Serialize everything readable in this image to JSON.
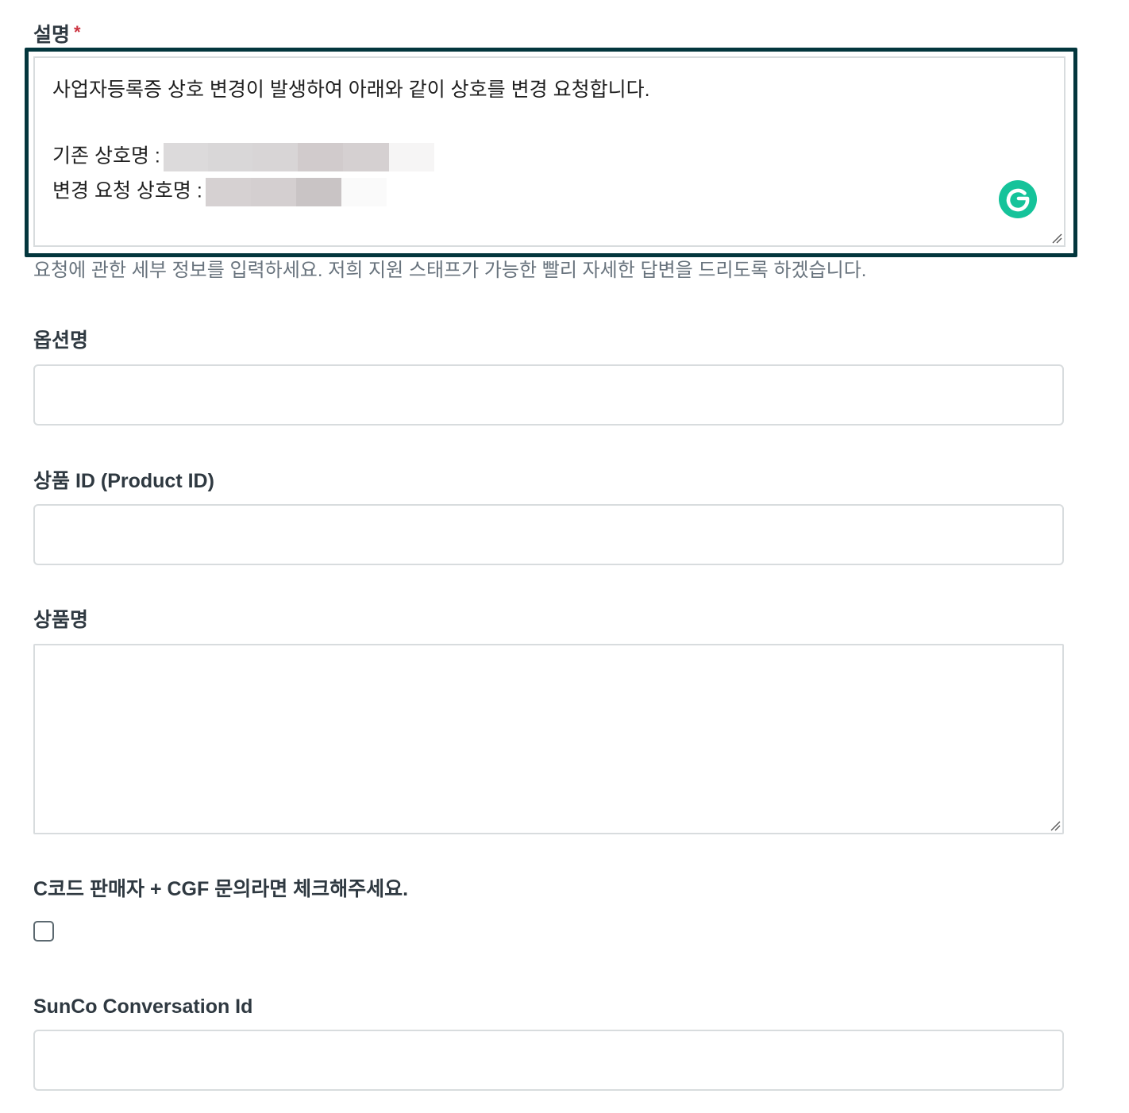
{
  "description": {
    "label": "설명",
    "required_marker": "*",
    "lines": {
      "line1": "사업자등록증 상호 변경이 발생하여 아래와 같이 상호를 변경 요청합니다.",
      "line2": "기존 상호명 :",
      "line3": "변경 요청 상호명 :"
    },
    "hint": "요청에 관한 세부 정보를 입력하세요. 저희 지원 스태프가 가능한 빨리 자세한 답변을 드리도록 하겠습니다."
  },
  "option_name": {
    "label": "옵션명",
    "value": ""
  },
  "product_id": {
    "label": "상품 ID (Product ID)",
    "value": ""
  },
  "product_name": {
    "label": "상품명",
    "value": ""
  },
  "cgf_check": {
    "label": "C코드 판매자 + CGF 문의라면 체크해주세요.",
    "checked": false
  },
  "sunco": {
    "label": "SunCo Conversation Id",
    "value": ""
  },
  "icons": {
    "grammarly": "grammarly-icon",
    "resize": "resize-grip-icon"
  },
  "colors": {
    "focus_ring": "#03363d",
    "required": "#cc3340",
    "grammarly": "#15c39a",
    "border": "#d8dcde",
    "hint": "#68737d"
  }
}
